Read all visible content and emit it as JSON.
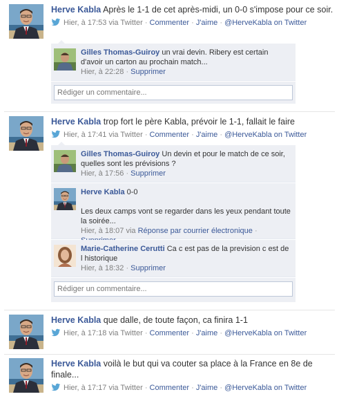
{
  "posts": [
    {
      "author": "Herve Kabla",
      "text": "Après le 1-1 de cet après-midi, un 0-0 s'impose pour ce soir.",
      "time": "Hier, à 17:53",
      "via": "via Twitter",
      "actions": [
        "Commenter",
        "J'aime",
        "@HerveKabla on Twitter"
      ],
      "comments": [
        {
          "author": "Gilles Thomas-Guiroy",
          "text": "un vrai devin. Ribery est certain d'avoir un carton au prochain match...",
          "time": "Hier, à 22:28",
          "action": "Supprimer"
        }
      ],
      "comment_placeholder": "Rédiger un commentaire..."
    },
    {
      "author": "Herve Kabla",
      "text": "trop fort le père Kabla, prévoir le 1-1, fallait le faire",
      "time": "Hier, à 17:41",
      "via": "via Twitter",
      "actions": [
        "Commenter",
        "J'aime",
        "@HerveKabla on Twitter"
      ],
      "comments": [
        {
          "author": "Gilles Thomas-Guiroy",
          "text": "Un devin et pour le match de ce soir, quelles sont les prévisions ?",
          "time": "Hier, à 17:56",
          "action": "Supprimer"
        },
        {
          "author": "Herve Kabla",
          "text": "0-0",
          "text2": "Les deux camps vont se regarder dans les yeux pendant toute la soirée...",
          "time": "Hier, à 18:07",
          "via": "via",
          "reply": "Réponse par courrier électronique",
          "action": "Supprimer"
        },
        {
          "author": "Marie-Catherine Cerutti",
          "text": "Ca c est pas de la prevision c est de l historique",
          "time": "Hier, à 18:32",
          "action": "Supprimer"
        }
      ],
      "comment_placeholder": "Rédiger un commentaire..."
    },
    {
      "author": "Herve Kabla",
      "text": "que dalle, de toute façon, ca finira 1-1",
      "time": "Hier, à 17:18",
      "via": "via Twitter",
      "actions": [
        "Commenter",
        "J'aime",
        "@HerveKabla on Twitter"
      ]
    },
    {
      "author": "Herve Kabla",
      "text": "voilà le but qui va couter sa place à la France en 8e de finale...",
      "time": "Hier, à 17:17",
      "via": "via Twitter",
      "actions": [
        "Commenter",
        "J'aime",
        "@HerveKabla on Twitter"
      ]
    }
  ],
  "colors": {
    "link": "#3b5998",
    "comment_bg": "#edeff4",
    "meta": "#808080"
  }
}
